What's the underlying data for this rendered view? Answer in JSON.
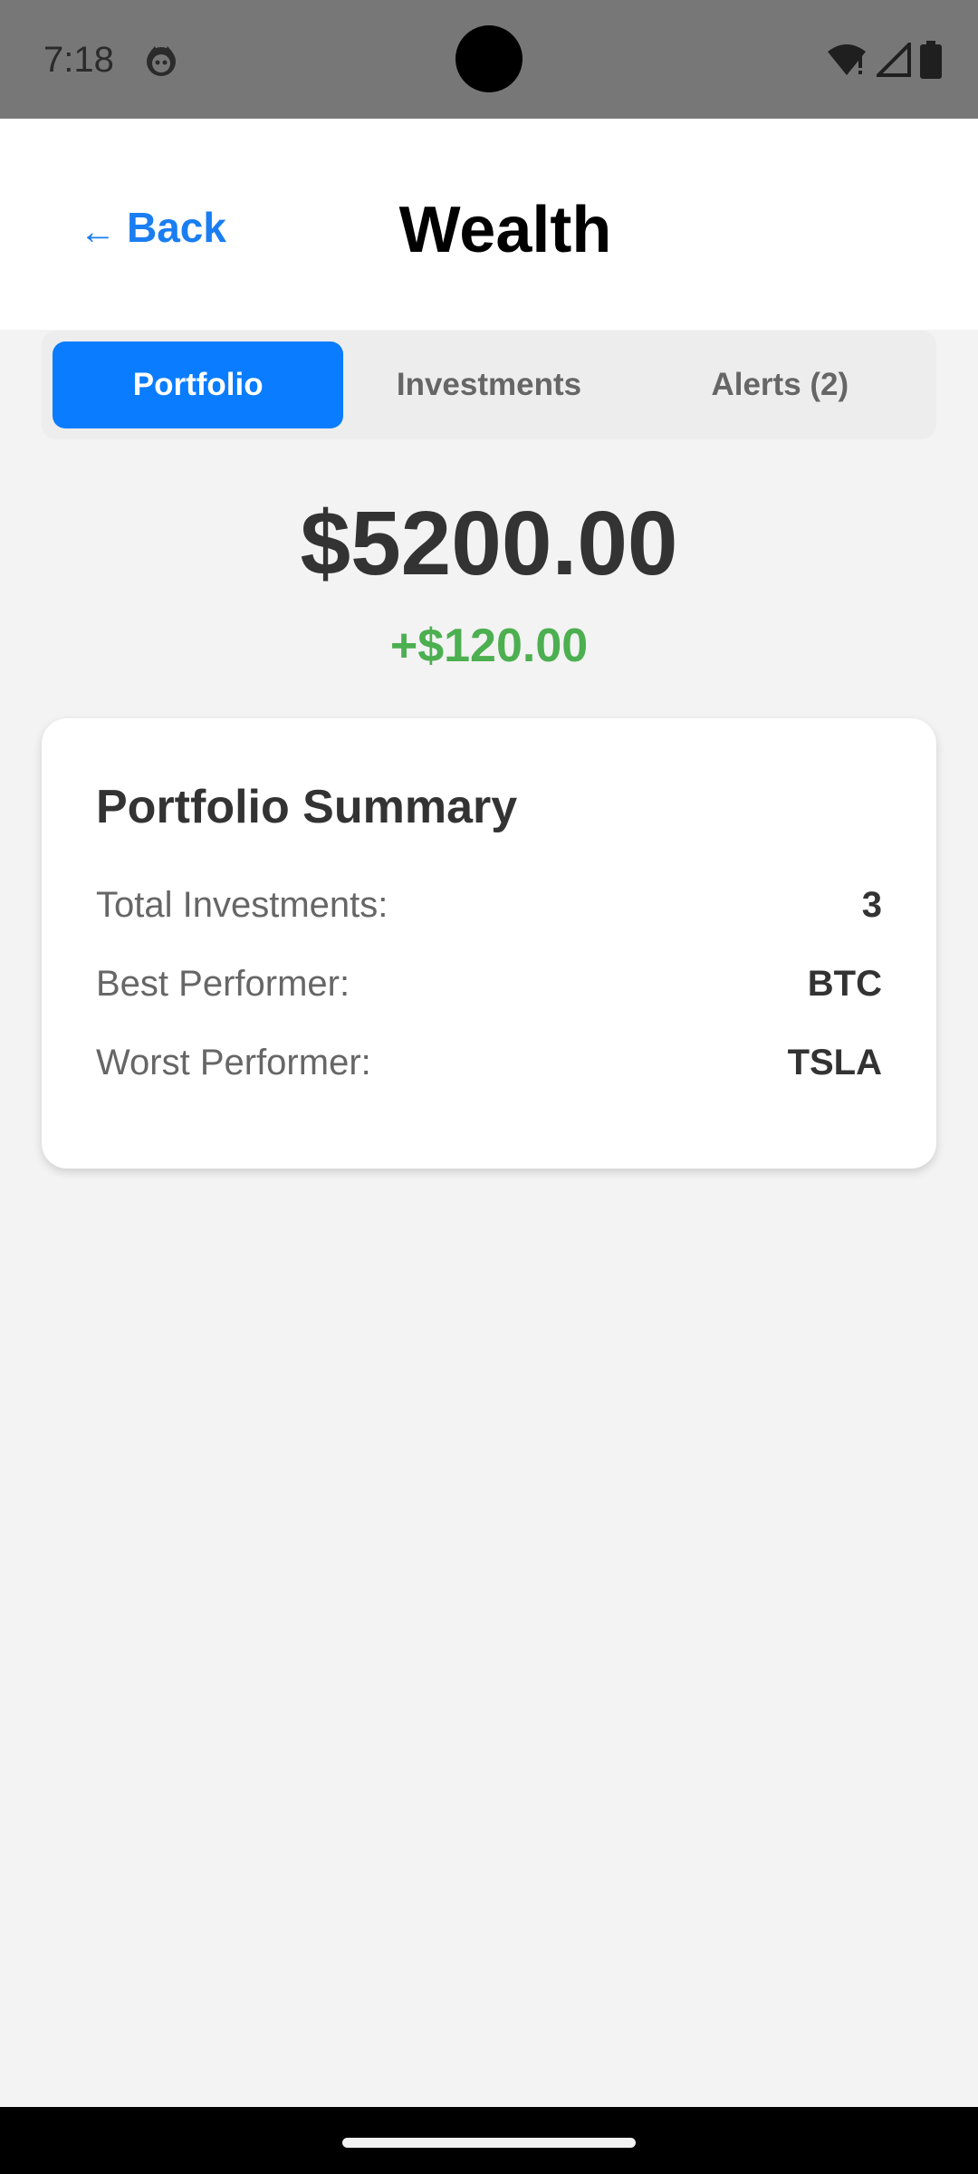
{
  "status_bar": {
    "time": "7:18",
    "icons": [
      "app-notification-icon",
      "wifi-icon",
      "signal-icon",
      "battery-icon"
    ]
  },
  "header": {
    "back_arrow": "←",
    "back_label": "Back",
    "title": "Wealth"
  },
  "tabs": [
    {
      "label": "Portfolio",
      "active": true
    },
    {
      "label": "Investments",
      "active": false
    },
    {
      "label": "Alerts (2)",
      "active": false
    }
  ],
  "balance": {
    "total": "$5200.00",
    "change": "+$120.00"
  },
  "summary": {
    "title": "Portfolio Summary",
    "rows": [
      {
        "label": "Total Investments:",
        "value": "3"
      },
      {
        "label": "Best Performer:",
        "value": "BTC"
      },
      {
        "label": "Worst Performer:",
        "value": "TSLA"
      }
    ]
  },
  "colors": {
    "accent": "#0a7cff",
    "link": "#1a7ef2",
    "positive": "#4caf50",
    "background": "#f3f3f3"
  }
}
